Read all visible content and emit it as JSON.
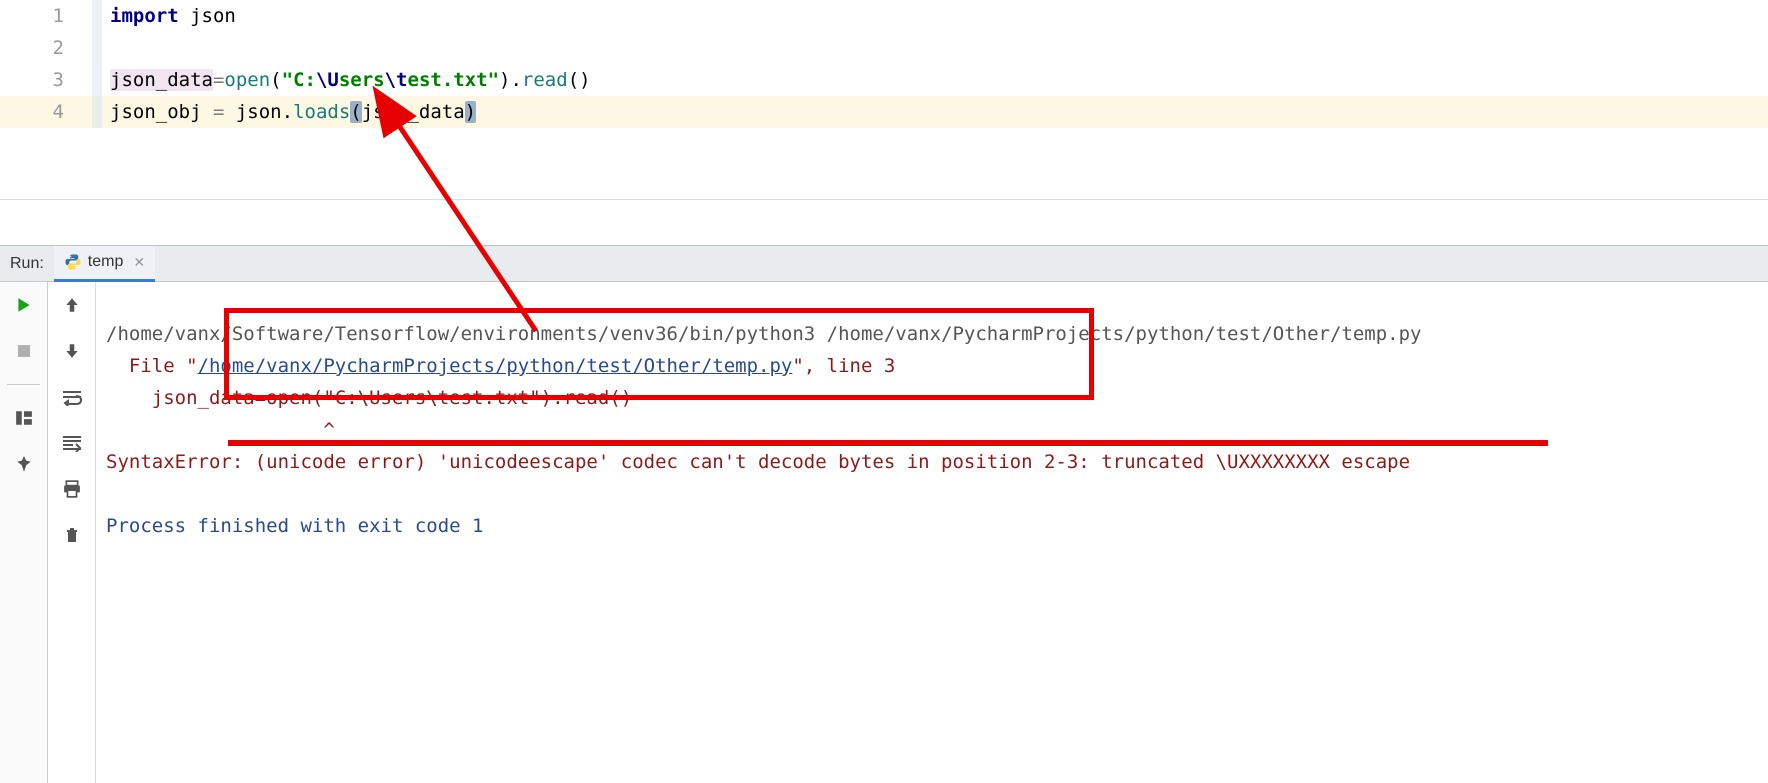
{
  "editor": {
    "lines": [
      {
        "num": "1"
      },
      {
        "num": "2"
      },
      {
        "num": "3"
      },
      {
        "num": "4"
      }
    ],
    "line1": {
      "import_kw": "import",
      "mod": "json"
    },
    "line3": {
      "var": "json_data",
      "assign": "=",
      "open": "open",
      "lp": "(",
      "str_open": "\"C:",
      "esc1": "\\U",
      "str_mid": "sers",
      "esc2": "\\t",
      "str_end": "est.txt\"",
      "rp": ")",
      "dot": ".",
      "read": "read",
      "lp2": "(",
      "rp2": ")"
    },
    "line4": {
      "var": "json_obj ",
      "assign": "= ",
      "mod": "json",
      "dot": ".",
      "loads": "loads",
      "lp": "(",
      "arg": "json_data",
      "rp": ")"
    }
  },
  "run": {
    "label": "Run:",
    "tab_name": "temp",
    "console": {
      "cmdline": "/home/vanx/Software/Tensorflow/environments/venv36/bin/python3 /home/vanx/PycharmProjects/python/test/Other/temp.py",
      "file_prefix": "  File \"",
      "file_path": "/home/vanx/PycharmProjects/python/test/Other/temp.py",
      "file_suffix": "\", line 3",
      "err_code": "    json_data=open(\"C:\\Users\\test.txt\").read()",
      "caret": "                   ^",
      "syntax_error": "SyntaxError: (unicode error) 'unicodeescape' codec can't decode bytes in position 2-3: truncated \\UXXXXXXXX escape",
      "blank": "",
      "status": "Process finished with exit code 1"
    }
  }
}
